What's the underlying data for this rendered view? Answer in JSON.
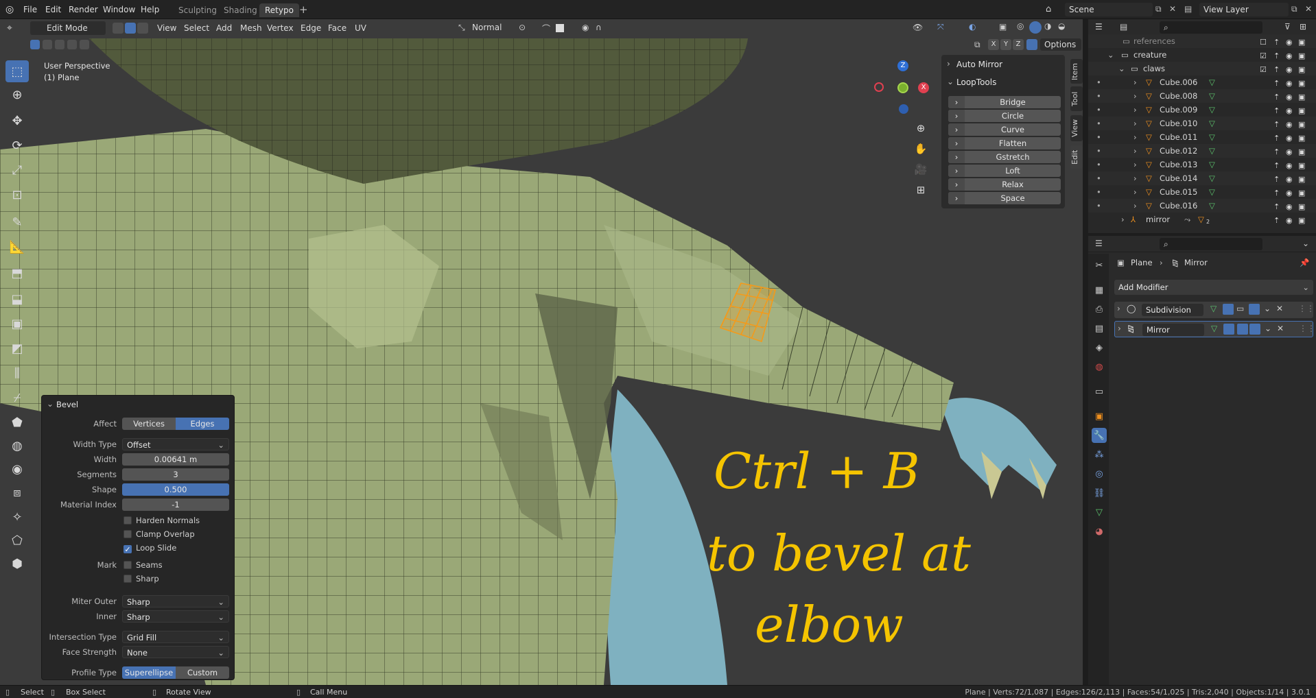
{
  "menus": [
    "File",
    "Edit",
    "Render",
    "Window",
    "Help"
  ],
  "workspaces": [
    {
      "label": "Sculpting",
      "active": false
    },
    {
      "label": "Shading",
      "active": false
    },
    {
      "label": "Retypo",
      "active": true
    }
  ],
  "scene": {
    "label": "Scene"
  },
  "view_layer": {
    "label": "View Layer"
  },
  "viewport_header": {
    "mode": "Edit Mode",
    "menus": [
      "View",
      "Select",
      "Add",
      "Mesh",
      "Vertex",
      "Edge",
      "Face",
      "UV"
    ],
    "orientation": "Normal",
    "options_label": "Options",
    "axes": [
      "X",
      "Y",
      "Z"
    ]
  },
  "overlay_text": {
    "perspective": "User Perspective",
    "object": "(1) Plane"
  },
  "gizmo": {
    "z": "Z",
    "x": "X"
  },
  "npanel": {
    "auto_mirror": "Auto Mirror",
    "looptools": "LoopTools",
    "items": [
      "Bridge",
      "Circle",
      "Curve",
      "Flatten",
      "Gstretch",
      "Loft",
      "Relax",
      "Space"
    ],
    "tabs": [
      "Item",
      "Tool",
      "View",
      "Edit"
    ]
  },
  "bevel": {
    "title": "Bevel",
    "affect_label": "Affect",
    "affect_options": [
      "Vertices",
      "Edges"
    ],
    "affect_selected": "Edges",
    "width_type_label": "Width Type",
    "width_type": "Offset",
    "width_label": "Width",
    "width": "0.00641 m",
    "segments_label": "Segments",
    "segments": "3",
    "shape_label": "Shape",
    "shape": "0.500",
    "shape_fill": 0.5,
    "material_label": "Material Index",
    "material": "-1",
    "harden_normals": "Harden Normals",
    "clamp_overlap": "Clamp Overlap",
    "loop_slide": "Loop Slide",
    "mark_label": "Mark",
    "seams": "Seams",
    "sharp": "Sharp",
    "miter_outer_label": "Miter Outer",
    "miter_outer": "Sharp",
    "inner_label": "Inner",
    "inner": "Sharp",
    "intersection_label": "Intersection Type",
    "intersection": "Grid Fill",
    "face_strength_label": "Face Strength",
    "face_strength": "None",
    "profile_label": "Profile Type",
    "profile_options": [
      "Superellipse",
      "Custom"
    ],
    "profile_selected": "Superellipse"
  },
  "annotation": {
    "line1": "Ctrl + B",
    "line2": "to bevel at",
    "line3": "elbow",
    "color": "#f5c400"
  },
  "outliner": {
    "rows": [
      {
        "label": "references",
        "indent": 1
      },
      {
        "label": "creature",
        "indent": 1
      },
      {
        "label": "claws",
        "indent": 2
      },
      {
        "label": "Cube.006",
        "indent": 3
      },
      {
        "label": "Cube.008",
        "indent": 3
      },
      {
        "label": "Cube.009",
        "indent": 3
      },
      {
        "label": "Cube.010",
        "indent": 3
      },
      {
        "label": "Cube.011",
        "indent": 3
      },
      {
        "label": "Cube.012",
        "indent": 3
      },
      {
        "label": "Cube.013",
        "indent": 3
      },
      {
        "label": "Cube.014",
        "indent": 3
      },
      {
        "label": "Cube.015",
        "indent": 3
      },
      {
        "label": "Cube.016",
        "indent": 3
      },
      {
        "label": "mirror",
        "indent": 2
      }
    ],
    "mirror_badge": "2"
  },
  "properties": {
    "breadcrumb_object": "Plane",
    "breadcrumb_modifier": "Mirror",
    "add_modifier": "Add Modifier",
    "modifiers": [
      "Subdivision",
      "Mirror"
    ]
  },
  "statusbar": {
    "select": "Select",
    "box_select": "Box Select",
    "rotate_view": "Rotate View",
    "call_menu": "Call Menu",
    "stats": "Plane | Verts:72/1,087 | Edges:126/2,113 | Faces:54/1,025 | Tris:2,040 | Objects:1/14 | 3.0.1"
  },
  "colors": {
    "accent": "#4772b3",
    "mesh": "#9aa877",
    "selection": "#f39a1b",
    "body_blue": "#7fb1c0"
  }
}
